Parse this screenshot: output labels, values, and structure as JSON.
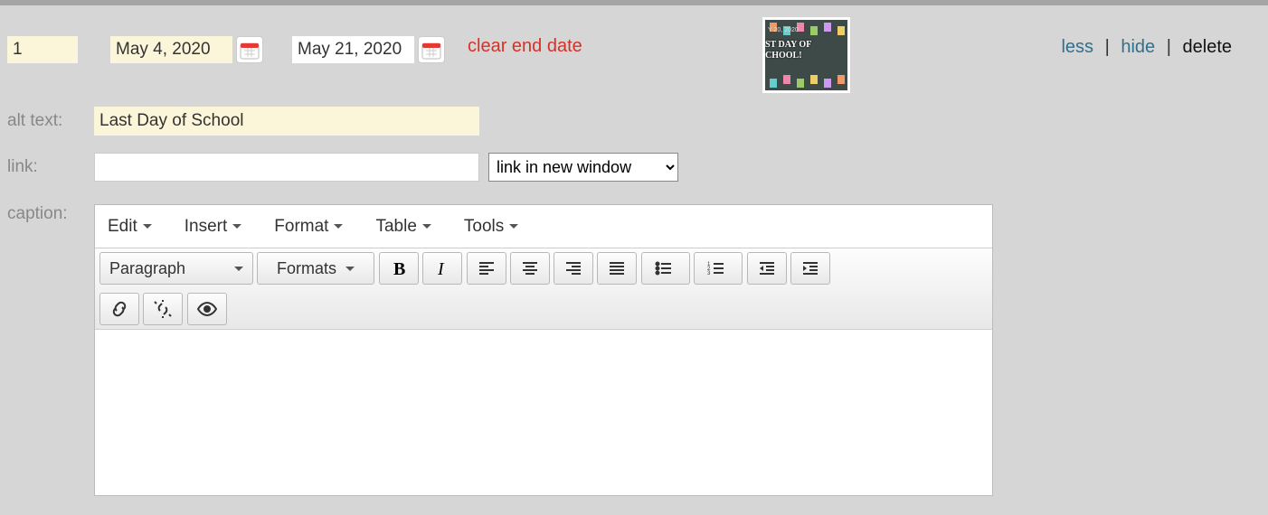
{
  "sequence": "1",
  "startDate": "May 4, 2020",
  "endDate": "May 21, 2020",
  "clearEnd": "clear end date",
  "thumb": {
    "dateLine": "Y 20, 2020",
    "line1": "ST DAY OF",
    "line2": "CHOOL!"
  },
  "actions": {
    "less": "less",
    "hide": "hide",
    "delete": "delete"
  },
  "labels": {
    "alt": "alt text:",
    "link": "link:",
    "caption": "caption:"
  },
  "altText": "Last Day of School",
  "linkValue": "",
  "linkTarget": "link in new window",
  "editor": {
    "menus": {
      "edit": "Edit",
      "insert": "Insert",
      "format": "Format",
      "table": "Table",
      "tools": "Tools"
    },
    "paragraph": "Paragraph",
    "formats": "Formats"
  }
}
